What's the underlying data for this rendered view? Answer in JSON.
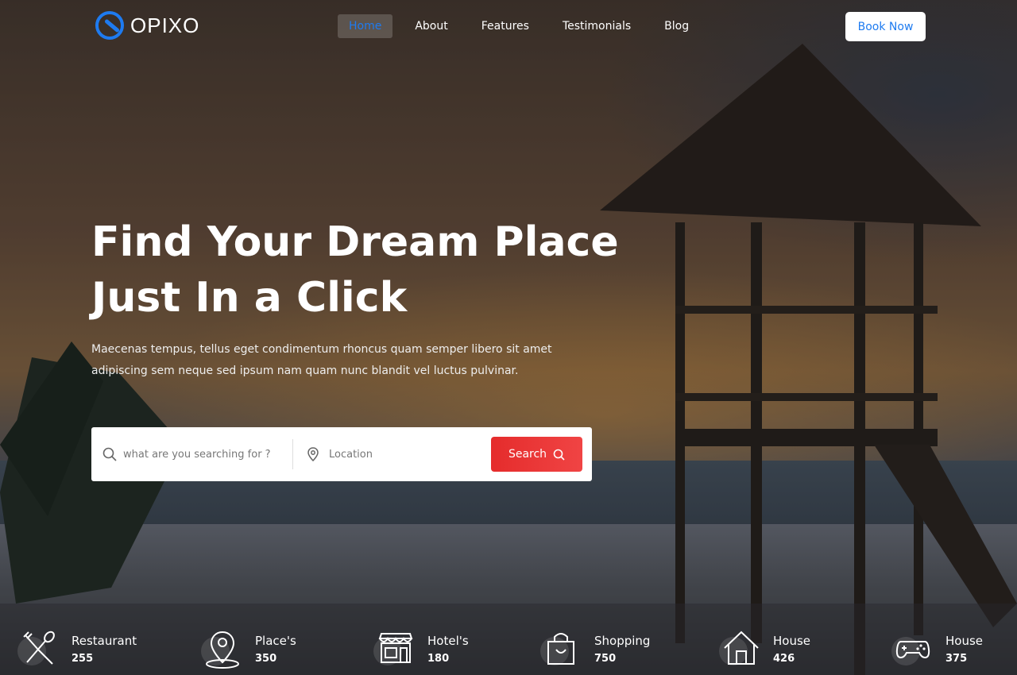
{
  "brand": {
    "name": "OPIXO"
  },
  "nav": {
    "items": [
      {
        "label": "Home",
        "active": true
      },
      {
        "label": "About",
        "active": false
      },
      {
        "label": "Features",
        "active": false
      },
      {
        "label": "Testimonials",
        "active": false
      },
      {
        "label": "Blog",
        "active": false
      }
    ],
    "cta_label": "Book Now"
  },
  "hero": {
    "title_line1": "Find Your Dream Place",
    "title_line2": "Just In a Click",
    "subtitle": "Maecenas tempus, tellus eget condimentum rhoncus quam semper libero sit amet adipiscing sem neque sed ipsum nam quam nunc blandit vel luctus pulvinar."
  },
  "search": {
    "query_placeholder": "what are you searching for ?",
    "location_placeholder": "Location",
    "button_label": "Search"
  },
  "categories": [
    {
      "name": "Restaurant",
      "count": "255",
      "icon": "fork-spoon-icon"
    },
    {
      "name": "Place's",
      "count": "350",
      "icon": "map-pin-icon"
    },
    {
      "name": "Hotel's",
      "count": "180",
      "icon": "storefront-icon"
    },
    {
      "name": "Shopping",
      "count": "750",
      "icon": "shopping-bag-icon"
    },
    {
      "name": "House",
      "count": "426",
      "icon": "house-icon"
    },
    {
      "name": "House",
      "count": "375",
      "icon": "gamepad-icon"
    }
  ],
  "colors": {
    "accent": "#1e7bf0",
    "search_button": "#e52c2c"
  }
}
